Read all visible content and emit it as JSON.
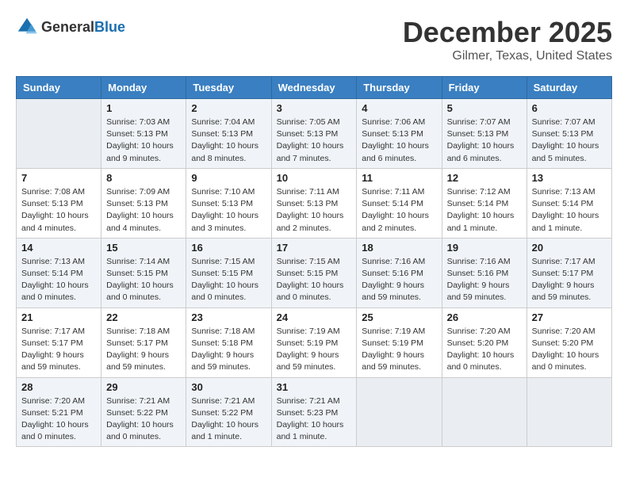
{
  "header": {
    "logo_general": "General",
    "logo_blue": "Blue",
    "month": "December 2025",
    "location": "Gilmer, Texas, United States"
  },
  "weekdays": [
    "Sunday",
    "Monday",
    "Tuesday",
    "Wednesday",
    "Thursday",
    "Friday",
    "Saturday"
  ],
  "weeks": [
    [
      {
        "day": "",
        "info": ""
      },
      {
        "day": "1",
        "info": "Sunrise: 7:03 AM\nSunset: 5:13 PM\nDaylight: 10 hours\nand 9 minutes."
      },
      {
        "day": "2",
        "info": "Sunrise: 7:04 AM\nSunset: 5:13 PM\nDaylight: 10 hours\nand 8 minutes."
      },
      {
        "day": "3",
        "info": "Sunrise: 7:05 AM\nSunset: 5:13 PM\nDaylight: 10 hours\nand 7 minutes."
      },
      {
        "day": "4",
        "info": "Sunrise: 7:06 AM\nSunset: 5:13 PM\nDaylight: 10 hours\nand 6 minutes."
      },
      {
        "day": "5",
        "info": "Sunrise: 7:07 AM\nSunset: 5:13 PM\nDaylight: 10 hours\nand 6 minutes."
      },
      {
        "day": "6",
        "info": "Sunrise: 7:07 AM\nSunset: 5:13 PM\nDaylight: 10 hours\nand 5 minutes."
      }
    ],
    [
      {
        "day": "7",
        "info": "Sunrise: 7:08 AM\nSunset: 5:13 PM\nDaylight: 10 hours\nand 4 minutes."
      },
      {
        "day": "8",
        "info": "Sunrise: 7:09 AM\nSunset: 5:13 PM\nDaylight: 10 hours\nand 4 minutes."
      },
      {
        "day": "9",
        "info": "Sunrise: 7:10 AM\nSunset: 5:13 PM\nDaylight: 10 hours\nand 3 minutes."
      },
      {
        "day": "10",
        "info": "Sunrise: 7:11 AM\nSunset: 5:13 PM\nDaylight: 10 hours\nand 2 minutes."
      },
      {
        "day": "11",
        "info": "Sunrise: 7:11 AM\nSunset: 5:14 PM\nDaylight: 10 hours\nand 2 minutes."
      },
      {
        "day": "12",
        "info": "Sunrise: 7:12 AM\nSunset: 5:14 PM\nDaylight: 10 hours\nand 1 minute."
      },
      {
        "day": "13",
        "info": "Sunrise: 7:13 AM\nSunset: 5:14 PM\nDaylight: 10 hours\nand 1 minute."
      }
    ],
    [
      {
        "day": "14",
        "info": "Sunrise: 7:13 AM\nSunset: 5:14 PM\nDaylight: 10 hours\nand 0 minutes."
      },
      {
        "day": "15",
        "info": "Sunrise: 7:14 AM\nSunset: 5:15 PM\nDaylight: 10 hours\nand 0 minutes."
      },
      {
        "day": "16",
        "info": "Sunrise: 7:15 AM\nSunset: 5:15 PM\nDaylight: 10 hours\nand 0 minutes."
      },
      {
        "day": "17",
        "info": "Sunrise: 7:15 AM\nSunset: 5:15 PM\nDaylight: 10 hours\nand 0 minutes."
      },
      {
        "day": "18",
        "info": "Sunrise: 7:16 AM\nSunset: 5:16 PM\nDaylight: 9 hours\nand 59 minutes."
      },
      {
        "day": "19",
        "info": "Sunrise: 7:16 AM\nSunset: 5:16 PM\nDaylight: 9 hours\nand 59 minutes."
      },
      {
        "day": "20",
        "info": "Sunrise: 7:17 AM\nSunset: 5:17 PM\nDaylight: 9 hours\nand 59 minutes."
      }
    ],
    [
      {
        "day": "21",
        "info": "Sunrise: 7:17 AM\nSunset: 5:17 PM\nDaylight: 9 hours\nand 59 minutes."
      },
      {
        "day": "22",
        "info": "Sunrise: 7:18 AM\nSunset: 5:17 PM\nDaylight: 9 hours\nand 59 minutes."
      },
      {
        "day": "23",
        "info": "Sunrise: 7:18 AM\nSunset: 5:18 PM\nDaylight: 9 hours\nand 59 minutes."
      },
      {
        "day": "24",
        "info": "Sunrise: 7:19 AM\nSunset: 5:19 PM\nDaylight: 9 hours\nand 59 minutes."
      },
      {
        "day": "25",
        "info": "Sunrise: 7:19 AM\nSunset: 5:19 PM\nDaylight: 9 hours\nand 59 minutes."
      },
      {
        "day": "26",
        "info": "Sunrise: 7:20 AM\nSunset: 5:20 PM\nDaylight: 10 hours\nand 0 minutes."
      },
      {
        "day": "27",
        "info": "Sunrise: 7:20 AM\nSunset: 5:20 PM\nDaylight: 10 hours\nand 0 minutes."
      }
    ],
    [
      {
        "day": "28",
        "info": "Sunrise: 7:20 AM\nSunset: 5:21 PM\nDaylight: 10 hours\nand 0 minutes."
      },
      {
        "day": "29",
        "info": "Sunrise: 7:21 AM\nSunset: 5:22 PM\nDaylight: 10 hours\nand 0 minutes."
      },
      {
        "day": "30",
        "info": "Sunrise: 7:21 AM\nSunset: 5:22 PM\nDaylight: 10 hours\nand 1 minute."
      },
      {
        "day": "31",
        "info": "Sunrise: 7:21 AM\nSunset: 5:23 PM\nDaylight: 10 hours\nand 1 minute."
      },
      {
        "day": "",
        "info": ""
      },
      {
        "day": "",
        "info": ""
      },
      {
        "day": "",
        "info": ""
      }
    ]
  ]
}
